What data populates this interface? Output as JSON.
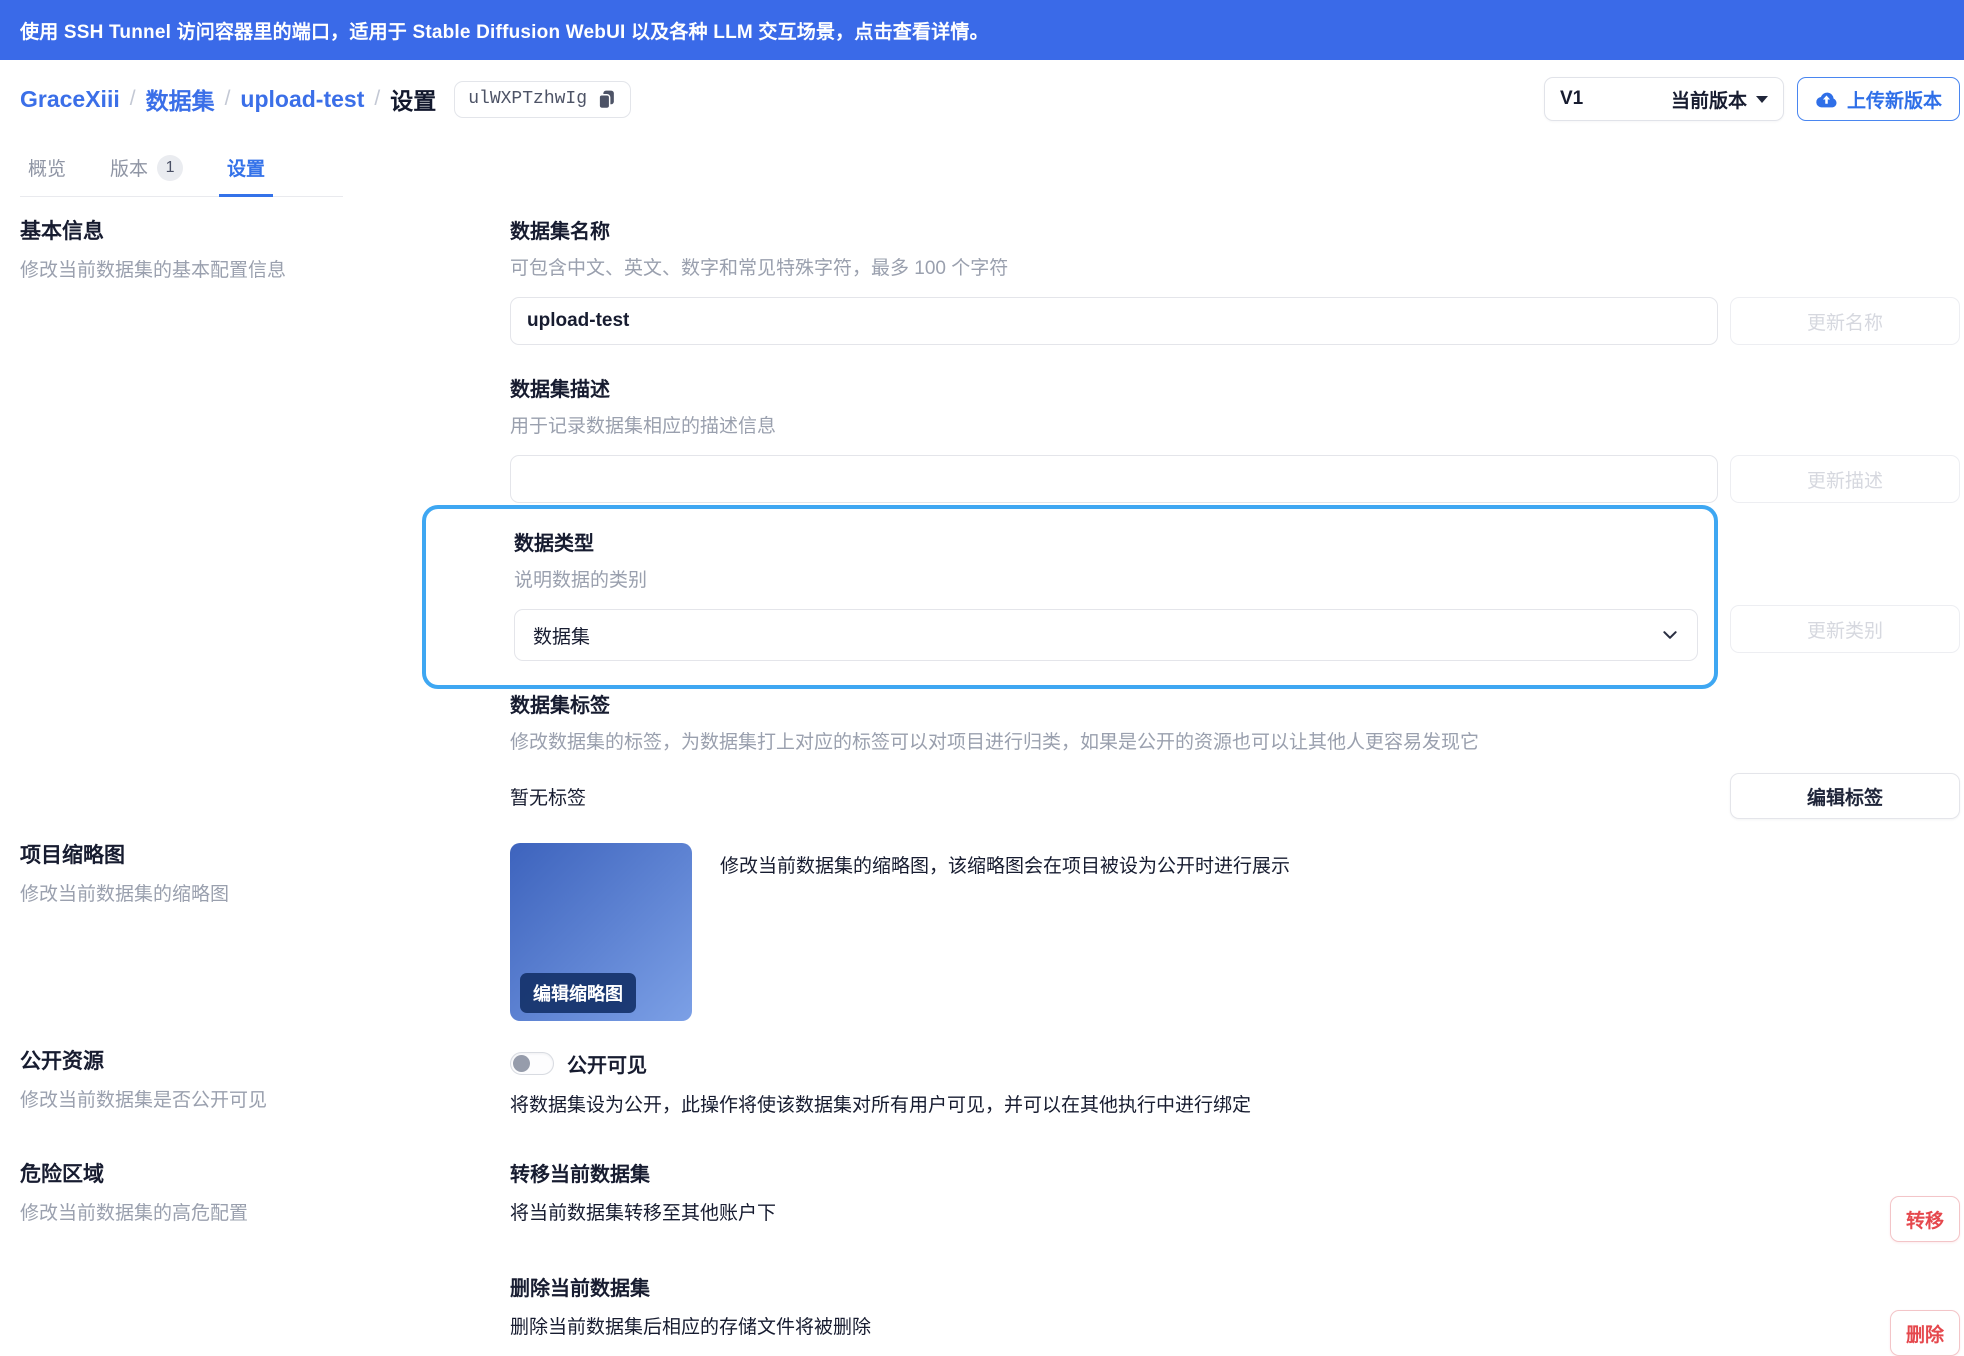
{
  "banner": {
    "text": "使用 SSH Tunnel 访问容器里的端口，适用于 Stable Diffusion WebUI 以及各种 LLM 交互场景，点击查看详情。"
  },
  "header": {
    "breadcrumb": {
      "user": "GraceXiii",
      "section": "数据集",
      "project": "upload-test",
      "page": "设置",
      "separator": "/"
    },
    "dataset_id": "ulWXPTzhwIg",
    "version_selector": {
      "version": "V1",
      "label": "当前版本"
    },
    "upload_button": "上传新版本"
  },
  "tabs": [
    {
      "label": "概览"
    },
    {
      "label": "版本",
      "badge": "1"
    },
    {
      "label": "设置",
      "active": true
    }
  ],
  "basic_info": {
    "title": "基本信息",
    "description": "修改当前数据集的基本配置信息",
    "name_field": {
      "label": "数据集名称",
      "hint": "可包含中文、英文、数字和常见特殊字符，最多 100 个字符",
      "value": "upload-test",
      "button": "更新名称"
    },
    "desc_field": {
      "label": "数据集描述",
      "hint": "用于记录数据集相应的描述信息",
      "value": "",
      "button": "更新描述"
    },
    "type_field": {
      "label": "数据类型",
      "hint": "说明数据的类别",
      "value": "数据集",
      "button": "更新类别"
    },
    "tags_field": {
      "label": "数据集标签",
      "hint": "修改数据集的标签，为数据集打上对应的标签可以对项目进行归类，如果是公开的资源也可以让其他人更容易发现它",
      "empty_text": "暂无标签",
      "button": "编辑标签"
    }
  },
  "thumbnail": {
    "title": "项目缩略图",
    "description": "修改当前数据集的缩略图",
    "edit_button": "编辑缩略图",
    "hint": "修改当前数据集的缩略图，该缩略图会在项目被设为公开时进行展示"
  },
  "public": {
    "title": "公开资源",
    "description": "修改当前数据集是否公开可见",
    "toggle_on": false,
    "toggle_label": "公开可见",
    "hint": "将数据集设为公开，此操作将使该数据集对所有用户可见，并可以在其他执行中进行绑定"
  },
  "danger": {
    "title": "危险区域",
    "description": "修改当前数据集的高危配置",
    "transfer": {
      "title": "转移当前数据集",
      "description": "将当前数据集转移至其他账户下",
      "button": "转移"
    },
    "delete": {
      "title": "删除当前数据集",
      "description": "删除当前数据集后相应的存储文件将被删除",
      "button": "删除"
    }
  },
  "colors": {
    "banner_blue": "#3a6ae8",
    "link_blue": "#3b6fe8",
    "tab_active_blue": "#3472e9",
    "highlight_ring": "#3ea7f2",
    "danger_red": "#e5484d",
    "thumb_gradient_start": "#3d63bd",
    "thumb_gradient_end": "#7ca0e6"
  }
}
